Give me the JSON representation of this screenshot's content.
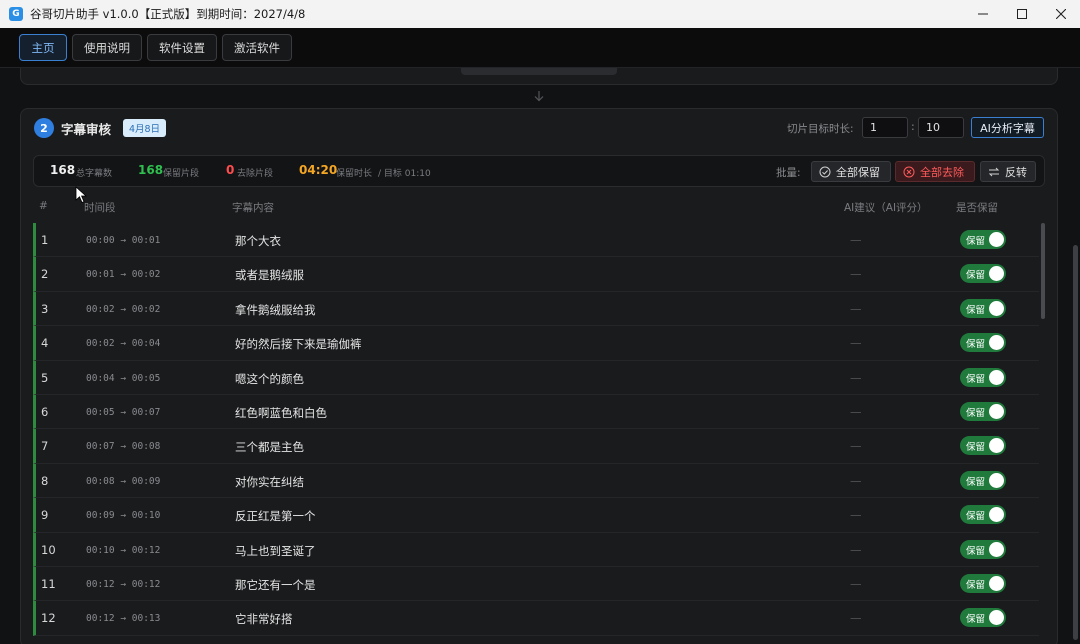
{
  "window": {
    "title": "谷哥切片助手 v1.0.0【正式版】到期时间：2027/4/8",
    "app_icon": "clip-app-icon"
  },
  "nav": {
    "home": "主页",
    "guide": "使用说明",
    "settings": "软件设置",
    "activate": "激活软件"
  },
  "card": {
    "step": "2",
    "title": "字幕审核",
    "date": "4月8日",
    "duration_label": "切片目标时长:",
    "duration_value_1": "1",
    "duration_sep": ":",
    "duration_value_2": "10",
    "ai_button": "AI分析字幕"
  },
  "stats": {
    "total_num": "168",
    "total_label": "总字幕数",
    "kept_num": "168",
    "kept_label": "保留片段",
    "removed_num": "0",
    "removed_label": "去除片段",
    "kept_time": "04:20",
    "kept_time_label": "保留时长",
    "target_label": "/ 目标 01:10",
    "batch_label": "批量:",
    "keep_all": "全部保留",
    "remove_all": "全部去除",
    "invert": "反转"
  },
  "table": {
    "headers": {
      "index": "#",
      "time": "时间段",
      "text": "字幕内容",
      "ai": "AI建议（AI评分）",
      "keep": "是否保留"
    },
    "rows": [
      {
        "idx": "1",
        "time": "00:00 → 00:01",
        "text": "那个大衣",
        "ai": "—",
        "keep": "保留"
      },
      {
        "idx": "2",
        "time": "00:01 → 00:02",
        "text": "或者是鹅绒服",
        "ai": "—",
        "keep": "保留"
      },
      {
        "idx": "3",
        "time": "00:02 → 00:02",
        "text": "拿件鹅绒服给我",
        "ai": "—",
        "keep": "保留"
      },
      {
        "idx": "4",
        "time": "00:02 → 00:04",
        "text": "好的然后接下来是瑜伽裤",
        "ai": "—",
        "keep": "保留"
      },
      {
        "idx": "5",
        "time": "00:04 → 00:05",
        "text": "嗯这个的颜色",
        "ai": "—",
        "keep": "保留"
      },
      {
        "idx": "6",
        "time": "00:05 → 00:07",
        "text": "红色啊蓝色和白色",
        "ai": "—",
        "keep": "保留"
      },
      {
        "idx": "7",
        "time": "00:07 → 00:08",
        "text": "三个都是主色",
        "ai": "—",
        "keep": "保留"
      },
      {
        "idx": "8",
        "time": "00:08 → 00:09",
        "text": "对你实在纠结",
        "ai": "—",
        "keep": "保留"
      },
      {
        "idx": "9",
        "time": "00:09 → 00:10",
        "text": "反正红是第一个",
        "ai": "—",
        "keep": "保留"
      },
      {
        "idx": "10",
        "time": "00:10 → 00:12",
        "text": "马上也到圣诞了",
        "ai": "—",
        "keep": "保留"
      },
      {
        "idx": "11",
        "time": "00:12 → 00:12",
        "text": "那它还有一个是",
        "ai": "—",
        "keep": "保留"
      },
      {
        "idx": "12",
        "time": "00:12 → 00:13",
        "text": "它非常好搭",
        "ai": "—",
        "keep": "保留"
      }
    ]
  },
  "colors": {
    "accent": "#2f7fe0",
    "kept_green": "#2fbf4f",
    "removed_red": "#ff4d4f",
    "time_orange": "#f5a623",
    "toggle_on": "#1f7a3c"
  }
}
